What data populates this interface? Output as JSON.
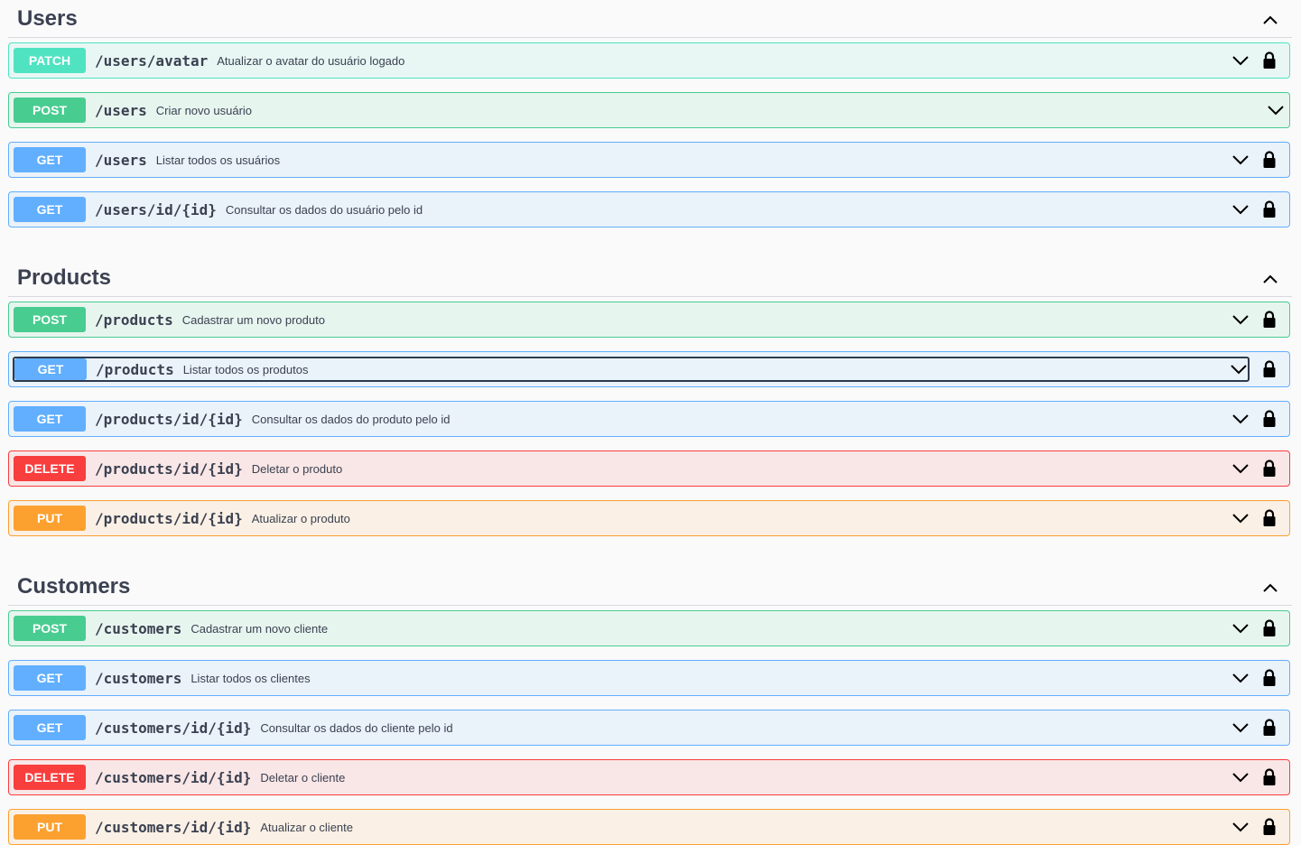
{
  "sections": [
    {
      "title": "Users",
      "operations": [
        {
          "method": "PATCH",
          "path": "/users/avatar",
          "summary": "Atualizar o avatar do usuário logado",
          "locked": true
        },
        {
          "method": "POST",
          "path": "/users",
          "summary": "Criar novo usuário",
          "locked": false
        },
        {
          "method": "GET",
          "path": "/users",
          "summary": "Listar todos os usuários",
          "locked": true
        },
        {
          "method": "GET",
          "path": "/users/id/{id}",
          "summary": "Consultar os dados do usuário pelo id",
          "locked": true
        }
      ]
    },
    {
      "title": "Products",
      "operations": [
        {
          "method": "POST",
          "path": "/products",
          "summary": "Cadastrar um novo produto",
          "locked": true
        },
        {
          "method": "GET",
          "path": "/products",
          "summary": "Listar todos os produtos",
          "locked": true,
          "focused": true
        },
        {
          "method": "GET",
          "path": "/products/id/{id}",
          "summary": "Consultar os dados do produto pelo id",
          "locked": true
        },
        {
          "method": "DELETE",
          "path": "/products/id/{id}",
          "summary": "Deletar o produto",
          "locked": true
        },
        {
          "method": "PUT",
          "path": "/products/id/{id}",
          "summary": "Atualizar o produto",
          "locked": true
        }
      ]
    },
    {
      "title": "Customers",
      "operations": [
        {
          "method": "POST",
          "path": "/customers",
          "summary": "Cadastrar um novo cliente",
          "locked": true
        },
        {
          "method": "GET",
          "path": "/customers",
          "summary": "Listar todos os clientes",
          "locked": true
        },
        {
          "method": "GET",
          "path": "/customers/id/{id}",
          "summary": "Consultar os dados do cliente pelo id",
          "locked": true
        },
        {
          "method": "DELETE",
          "path": "/customers/id/{id}",
          "summary": "Deletar o cliente",
          "locked": true
        },
        {
          "method": "PUT",
          "path": "/customers/id/{id}",
          "summary": "Atualizar o cliente",
          "locked": true
        }
      ]
    }
  ],
  "method_colors": {
    "PATCH": "#50e3c2",
    "POST": "#49cc90",
    "GET": "#61affe",
    "DELETE": "#f93e3e",
    "PUT": "#fca130"
  }
}
